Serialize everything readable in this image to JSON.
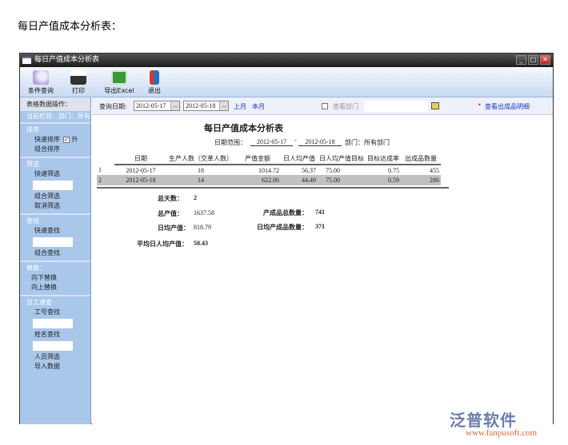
{
  "caption": "每日产值成本分析表：",
  "window": {
    "title": "每日产值成本分析表",
    "min": "_",
    "max": "□",
    "close": "✕"
  },
  "toolbar": [
    {
      "label": "条件查询",
      "icon": "search-icon"
    },
    {
      "label": "打印",
      "icon": "printer-icon"
    },
    {
      "label": "导出Excel",
      "icon": "excel-icon"
    },
    {
      "label": "退出",
      "icon": "exit-icon"
    }
  ],
  "left": {
    "header": "表格数据操作：",
    "current": "当前栏目：部门：所有部门",
    "sort": {
      "title": "排序",
      "quick": "快速排序",
      "asc": "升",
      "combo": "组合排序"
    },
    "filter": {
      "title": "筛选",
      "quick": "快速筛选",
      "combo": "组合筛选",
      "cancel": "取消筛选"
    },
    "find": {
      "title": "查找",
      "quick": "快速查找",
      "combo": "组合查找"
    },
    "replace": {
      "title": "替换：",
      "down": "向下替换",
      "up": "向上替换"
    },
    "staff": {
      "title": "员工速查",
      "byid": "工号查找",
      "byname": "姓名查找",
      "filter": "人员筛选",
      "import": "导入数据"
    }
  },
  "query": {
    "label": "查询日期:",
    "from": "2012-05-17",
    "to": "2012-05-18",
    "btn": "...",
    "last_month": "上月",
    "this_month": "本月",
    "dept_label": "查看部门",
    "dept_value": "",
    "detail_link": "查看出成品明细"
  },
  "report": {
    "title": "每日产值成本分析表",
    "range_label": "日期范围：",
    "range_from": "2012-05-17",
    "dash": "-",
    "range_to": "2012-05-18",
    "dept": "部门：所有部门",
    "columns": [
      "日期",
      "生产人数（交革人数）",
      "产值金额",
      "日人均产值",
      "日人均产值目标",
      "目标达成率",
      "出成品数量"
    ],
    "rows": [
      {
        "n": "1",
        "cells": [
          "2012-05-17",
          "18",
          "1014.72",
          "56.37",
          "75.00",
          "0.75",
          "455"
        ]
      },
      {
        "n": "2",
        "cells": [
          "2012-05-18",
          "14",
          "622.86",
          "44.49",
          "75.00",
          "0.59",
          "286"
        ]
      }
    ],
    "summary": {
      "days_label": "总天数：",
      "days": "2",
      "total_label": "总产值：",
      "total": "1637.58",
      "qty_label": "产成品总数量：",
      "qty": "741",
      "avg_label": "日均产值：",
      "avg": "818.79",
      "avgqty_label": "日均产成品数量：",
      "avgqty": "371",
      "per_label": "平均日人均产值：",
      "per": "50.43"
    }
  },
  "watermark": {
    "brand": "泛普软件",
    "url": "www.fanpusoft.com"
  }
}
